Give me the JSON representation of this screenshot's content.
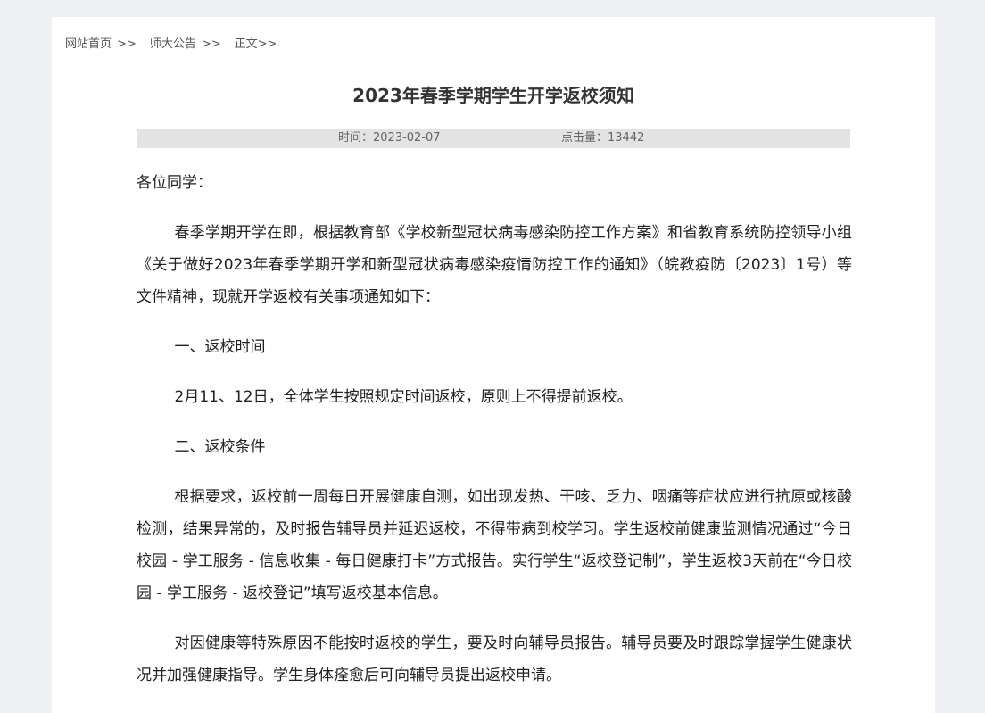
{
  "breadcrumb": {
    "home": "网站首页",
    "section": "师大公告",
    "current": "正文",
    "separator": ">>"
  },
  "article": {
    "title": "2023年春季学期学生开学返校须知",
    "date_label": "时间：",
    "date": "2023-02-07",
    "clicks_label": "点击量：",
    "clicks": "13442",
    "paragraphs": [
      "各位同学：",
      "春季学期开学在即，根据教育部《学校新型冠状病毒感染防控工作方案》和省教育系统防控领导小组《关于做好2023年春季学期开学和新型冠状病毒感染疫情防控工作的通知》（皖教疫防〔2023〕1号）等文件精神，现就开学返校有关事项通知如下：",
      "一、返校时间",
      "2月11、12日，全体学生按照规定时间返校，原则上不得提前返校。",
      "二、返校条件",
      "根据要求，返校前一周每日开展健康自测，如出现发热、干咳、乏力、咽痛等症状应进行抗原或核酸检测，结果异常的，及时报告辅导员并延迟返校，不得带病到校学习。学生返校前健康监测情况通过“今日校园 - 学工服务 - 信息收集 - 每日健康打卡”方式报告。实行学生“返校登记制”，学生返校3天前在“今日校园 - 学工服务 - 返校登记”填写返校基本信息。",
      "对因健康等特殊原因不能按时返校的学生，要及时向辅导员报告。辅导员要及时跟踪掌握学生健康状况并加强健康指导。学生身体痊愈后可向辅导员提出返校申请。"
    ]
  }
}
